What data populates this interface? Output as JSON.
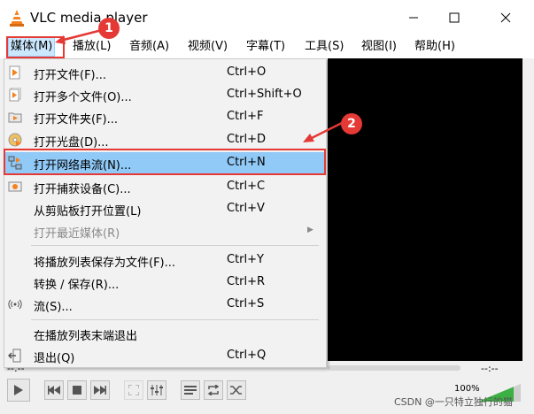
{
  "window": {
    "title": "VLC media player",
    "controls": {
      "minimize": "minimize-icon",
      "maximize": "maximize-icon",
      "close": "close-icon"
    }
  },
  "menubar": [
    {
      "label": "媒体(M)",
      "active": true
    },
    {
      "label": "播放(L)"
    },
    {
      "label": "音频(A)"
    },
    {
      "label": "视频(V)"
    },
    {
      "label": "字幕(T)"
    },
    {
      "label": "工具(S)"
    },
    {
      "label": "视图(I)"
    },
    {
      "label": "帮助(H)"
    }
  ],
  "media_menu": {
    "items": [
      {
        "label": "打开文件(F)...",
        "shortcut": "Ctrl+O",
        "icon": "file-play-icon"
      },
      {
        "label": "打开多个文件(O)...",
        "shortcut": "Ctrl+Shift+O",
        "icon": "files-play-icon"
      },
      {
        "label": "打开文件夹(F)...",
        "shortcut": "Ctrl+F",
        "icon": "folder-icon"
      },
      {
        "label": "打开光盘(D)...",
        "shortcut": "Ctrl+D",
        "icon": "disc-icon"
      },
      {
        "label": "打开网络串流(N)...",
        "shortcut": "Ctrl+N",
        "icon": "network-icon",
        "highlighted": true
      },
      {
        "label": "打开捕获设备(C)...",
        "shortcut": "Ctrl+C",
        "icon": "capture-device-icon"
      },
      {
        "label": "从剪贴板打开位置(L)",
        "shortcut": "Ctrl+V",
        "icon": ""
      },
      {
        "label": "打开最近媒体(R)",
        "shortcut": "",
        "icon": "",
        "disabled": true,
        "submenu": true
      },
      {
        "label": "将播放列表保存为文件(F)...",
        "shortcut": "Ctrl+Y",
        "icon": ""
      },
      {
        "label": "转换 / 保存(R)...",
        "shortcut": "Ctrl+R",
        "icon": ""
      },
      {
        "label": "流(S)...",
        "shortcut": "Ctrl+S",
        "icon": "stream-icon"
      },
      {
        "label": "在播放列表末端退出",
        "shortcut": "",
        "icon": ""
      },
      {
        "label": "退出(Q)",
        "shortcut": "Ctrl+Q",
        "icon": "exit-icon"
      }
    ]
  },
  "player": {
    "time_elapsed": "--:--",
    "time_total": "--:--",
    "volume": "100%",
    "volume_level": 1.0
  },
  "annotations": {
    "badge1": "1",
    "badge2": "2"
  },
  "watermark": "CSDN @一只特立独行的猫",
  "colors": {
    "annotation_red": "#e53935",
    "highlight": "#91c9f7",
    "vlc_orange": "#f58220"
  }
}
